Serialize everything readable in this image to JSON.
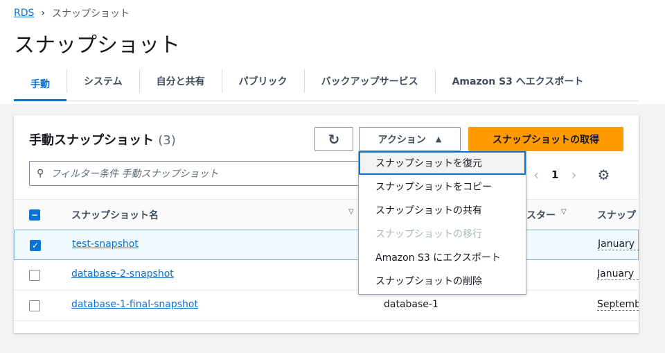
{
  "breadcrumb": {
    "root": "RDS",
    "current": "スナップショット"
  },
  "title": "スナップショット",
  "tabs": [
    "手動",
    "システム",
    "自分と共有",
    "パブリック",
    "バックアップサービス",
    "Amazon S3 へエクスポート"
  ],
  "panel": {
    "title": "手動スナップショット",
    "count": "(3)",
    "actions_label": "アクション",
    "take_snapshot_label": "スナップショットの取得",
    "search_placeholder": "フィルター条件 手動スナップショット",
    "page": "1"
  },
  "columns": [
    "スナップショット名",
    "スター",
    "スナップ"
  ],
  "rows": [
    {
      "name": "test-snapshot",
      "instance": "",
      "date": "January",
      "selected": true
    },
    {
      "name": "database-2-snapshot",
      "instance": "",
      "date": "January",
      "selected": false
    },
    {
      "name": "database-1-final-snapshot",
      "instance": "database-1",
      "date": "Septemb",
      "selected": false
    }
  ],
  "menu": [
    "スナップショットを復元",
    "スナップショットをコピー",
    "スナップショットの共有",
    "スナップショットの移行",
    "Amazon S3 にエクスポート",
    "スナップショットの削除"
  ],
  "colors": {
    "accent": "#0972d3",
    "primary": "#ff9900"
  }
}
